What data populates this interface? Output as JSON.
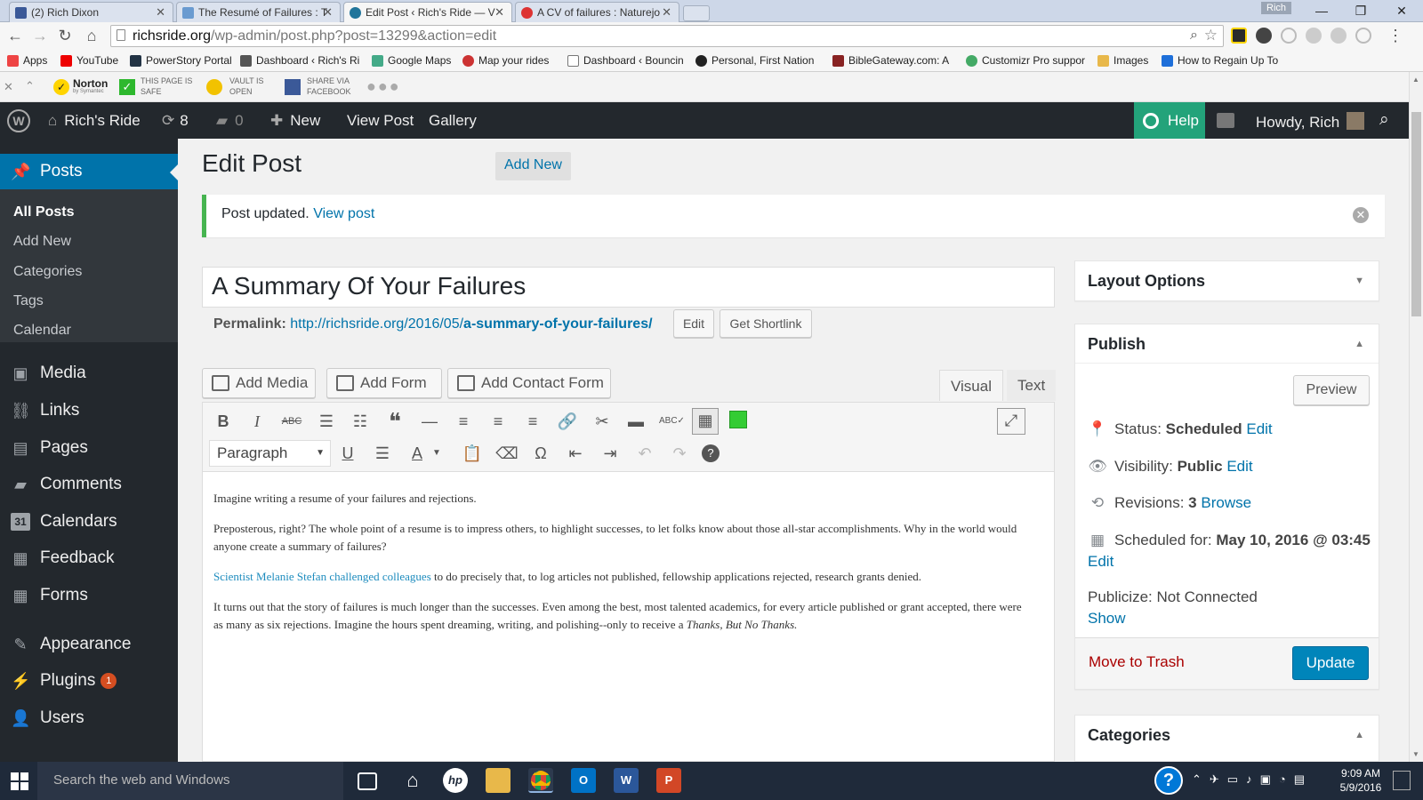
{
  "browser": {
    "tabs": [
      {
        "title": "(2) Rich Dixon",
        "icon": "facebook-icon",
        "color": "#3b5998"
      },
      {
        "title": "The Resumé of Failures : T",
        "icon": "page-icon",
        "color": "#6a9bd0"
      },
      {
        "title": "Edit Post ‹ Rich's Ride — V",
        "icon": "wordpress-icon",
        "color": "#21759b"
      },
      {
        "title": "A CV of failures : Naturejo",
        "icon": "nature-icon",
        "color": "#d33"
      }
    ],
    "profile": "Rich",
    "url_host": "richsride.org",
    "url_path": "/wp-admin/post.php?post=13299&action=edit",
    "bookmarks": [
      {
        "label": "Apps",
        "color": "#e44"
      },
      {
        "label": "YouTube",
        "color": "#e00"
      },
      {
        "label": "PowerStory Portal",
        "color": "#234"
      },
      {
        "label": "Dashboard ‹ Rich's Ri",
        "color": "#555"
      },
      {
        "label": "Google Maps",
        "color": "#4a8"
      },
      {
        "label": "Map your rides",
        "color": "#c33"
      },
      {
        "label": "Dashboard ‹ Bouncin",
        "color": "#777"
      },
      {
        "label": "Personal, First Nation",
        "color": "#222"
      },
      {
        "label": "BibleGateway.com: A",
        "color": "#822"
      },
      {
        "label": "Customizr Pro suppor",
        "color": "#4a6"
      },
      {
        "label": "Images",
        "color": "#e8b84a"
      },
      {
        "label": "How to Regain Up To",
        "color": "#1e6fd9"
      }
    ]
  },
  "norton": {
    "brand": "Norton",
    "brand_sub": "by Symantec",
    "safe_line1": "THIS PAGE IS",
    "safe_line2": "SAFE",
    "vault_line1": "VAULT IS",
    "vault_line2": "OPEN",
    "share_line1": "SHARE VIA",
    "share_line2": "FACEBOOK"
  },
  "adminbar": {
    "site_name": "Rich's Ride",
    "updates_count": "8",
    "comments_count": "0",
    "new_label": "New",
    "view_post": "View Post",
    "gallery": "Gallery",
    "help": "Help",
    "howdy": "Howdy, Rich"
  },
  "sidebar": {
    "active": "Posts",
    "sub_items": [
      "All Posts",
      "Add New",
      "Categories",
      "Tags",
      "Calendar"
    ],
    "items": [
      {
        "label": "Media",
        "icon": "media-icon"
      },
      {
        "label": "Links",
        "icon": "links-icon"
      },
      {
        "label": "Pages",
        "icon": "pages-icon"
      },
      {
        "label": "Comments",
        "icon": "comments-icon"
      },
      {
        "label": "Calendars",
        "icon": "calendar-icon"
      },
      {
        "label": "Feedback",
        "icon": "feedback-icon"
      },
      {
        "label": "Forms",
        "icon": "forms-icon"
      },
      {
        "label": "Appearance",
        "icon": "appearance-icon"
      },
      {
        "label": "Plugins",
        "icon": "plugins-icon"
      },
      {
        "label": "Users",
        "icon": "users-icon"
      }
    ],
    "plugins_badge": "1"
  },
  "page": {
    "title": "Edit Post",
    "add_new": "Add New",
    "notice_text": "Post updated.",
    "notice_link": "View post",
    "post_title": "A Summary Of Your Failures",
    "permalink_label": "Permalink:",
    "permalink_base": "http://richsride.org/2016/05/",
    "permalink_slug": "a-summary-of-your-failures/",
    "edit_btn": "Edit",
    "shortlink_btn": "Get Shortlink",
    "add_media": "Add Media",
    "add_form": "Add Form",
    "add_contact_form": "Add Contact Form",
    "tab_visual": "Visual",
    "tab_text": "Text",
    "format_select": "Paragraph"
  },
  "content": {
    "p1": "Imagine writing a resume of your failures and rejections.",
    "p2": "Preposterous, right? The whole point of a resume is to impress others, to highlight successes, to let folks know about those all-star accomplishments. Why in the world would anyone create a summary of failures?",
    "p3_link": "Scientist Melanie Stefan challenged colleagues",
    "p3_rest": " to do precisely that, to log articles not published, fellowship applications rejected, research grants denied.",
    "p4": "It turns out that the story of failures is much longer than the successes. Even among the best, most talented academics, for every article published or grant accepted, there were as many as six rejections. Imagine the hours spent dreaming, writing, and polishing--only to receive a ",
    "p4_em": "Thanks, But No Thanks."
  },
  "publish": {
    "layout_options": "Layout Options",
    "title": "Publish",
    "preview": "Preview",
    "status_label": "Status:",
    "status_value": "Scheduled",
    "visibility_label": "Visibility:",
    "visibility_value": "Public",
    "revisions_label": "Revisions:",
    "revisions_value": "3",
    "browse": "Browse",
    "scheduled_label": "Scheduled for:",
    "scheduled_value": "May 10, 2016 @ 03:45",
    "edit": "Edit",
    "publicize": "Publicize: Not Connected",
    "show": "Show",
    "trash": "Move to Trash",
    "update": "Update",
    "categories": "Categories"
  },
  "taskbar": {
    "search_placeholder": "Search the web and Windows",
    "time": "9:09 AM",
    "date": "5/9/2016"
  }
}
